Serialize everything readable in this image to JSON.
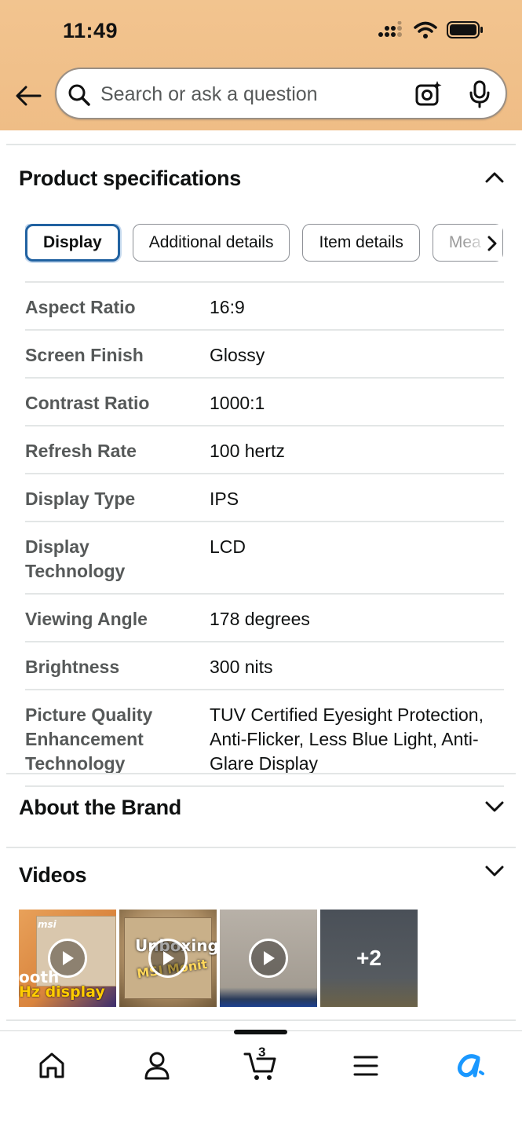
{
  "status_bar": {
    "time": "11:49"
  },
  "search": {
    "placeholder": "Search or ask a question"
  },
  "product_specs": {
    "title": "Product specifications",
    "tabs": [
      "Display",
      "Additional details",
      "Item details",
      "Mea"
    ],
    "active_tab": "Display",
    "rows": [
      {
        "key": "Aspect Ratio",
        "value": "16:9"
      },
      {
        "key": "Screen Finish",
        "value": "Glossy"
      },
      {
        "key": "Contrast Ratio",
        "value": "1000:1"
      },
      {
        "key": "Refresh Rate",
        "value": "100 hertz"
      },
      {
        "key": "Display Type",
        "value": "IPS"
      },
      {
        "key": "Display Technology",
        "value": "LCD"
      },
      {
        "key": "Viewing Angle",
        "value": "178 degrees"
      },
      {
        "key": "Brightness",
        "value": "300 nits"
      },
      {
        "key": "Picture Quality Enhancement Technology",
        "value": "TUV Certified Eyesight Protection, Anti-Flicker, Less Blue Light, Anti-Glare Display"
      }
    ]
  },
  "about_brand": {
    "title": "About the Brand"
  },
  "videos": {
    "title": "Videos",
    "thumb1_texts": [
      "msi",
      "ooth",
      "Hz display"
    ],
    "thumb2_texts": [
      "Unboxing",
      "MSI Monit"
    ],
    "more_count": "+2"
  },
  "bottom_nav": {
    "cart_count": "3"
  },
  "colors": {
    "header": "#f2c48f",
    "active_tab_border": "#2162a1",
    "alexa": "#1a98ff"
  }
}
